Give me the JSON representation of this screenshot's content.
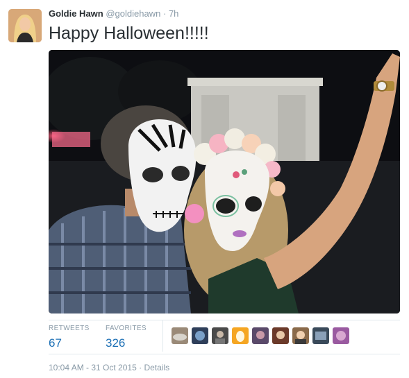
{
  "user": {
    "name": "Goldie Hawn",
    "handle": "@goldiehawn",
    "separator": "·",
    "time": "7h"
  },
  "tweet": {
    "text": "Happy Halloween!!!!!"
  },
  "stats": {
    "retweets_label": "RETWEETS",
    "retweets_value": "67",
    "favorites_label": "FAVORITES",
    "favorites_value": "326"
  },
  "favoriters": [
    {
      "icon": "avatar-icon",
      "color": "#9a8a78"
    },
    {
      "icon": "avatar-icon",
      "color": "#2f3f5a"
    },
    {
      "icon": "avatar-icon",
      "color": "#4a4a4a"
    },
    {
      "icon": "avatar-icon",
      "color": "#f5a623"
    },
    {
      "icon": "avatar-icon",
      "color": "#5a4a6a"
    },
    {
      "icon": "avatar-icon",
      "color": "#6b3a2a"
    },
    {
      "icon": "avatar-icon",
      "color": "#8a6a4a"
    },
    {
      "icon": "avatar-icon",
      "color": "#3a4a5a"
    },
    {
      "icon": "avatar-icon",
      "color": "#9a5aa0"
    }
  ],
  "footer": {
    "timestamp": "10:04 AM - 31 Oct 2015",
    "separator": "·",
    "details": "Details"
  },
  "colors": {
    "link": "#1b6fb5",
    "muted": "#8899a6",
    "text": "#292f33"
  }
}
